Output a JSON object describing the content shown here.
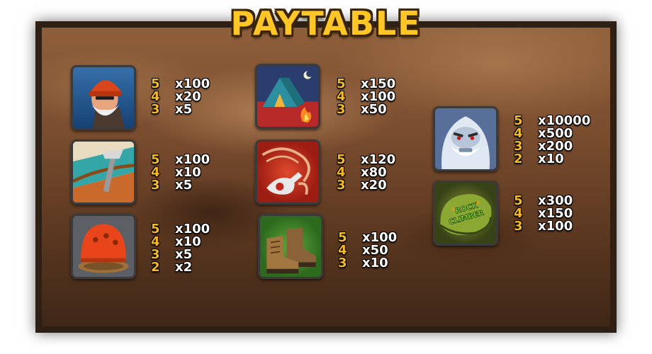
{
  "title": "PAYTABLE",
  "symbols": [
    {
      "name": "climber",
      "pays": [
        {
          "count": "5",
          "mult": "x100"
        },
        {
          "count": "4",
          "mult": "x20"
        },
        {
          "count": "3",
          "mult": "x5"
        }
      ]
    },
    {
      "name": "ice-axe",
      "pays": [
        {
          "count": "5",
          "mult": "x100"
        },
        {
          "count": "4",
          "mult": "x10"
        },
        {
          "count": "3",
          "mult": "x5"
        }
      ]
    },
    {
      "name": "helmet",
      "pays": [
        {
          "count": "5",
          "mult": "x100"
        },
        {
          "count": "4",
          "mult": "x10"
        },
        {
          "count": "3",
          "mult": "x5"
        },
        {
          "count": "2",
          "mult": "x2"
        }
      ]
    },
    {
      "name": "tent",
      "pays": [
        {
          "count": "5",
          "mult": "x150"
        },
        {
          "count": "4",
          "mult": "x100"
        },
        {
          "count": "3",
          "mult": "x50"
        }
      ]
    },
    {
      "name": "rope-hook",
      "pays": [
        {
          "count": "5",
          "mult": "x120"
        },
        {
          "count": "4",
          "mult": "x80"
        },
        {
          "count": "3",
          "mult": "x20"
        }
      ]
    },
    {
      "name": "boots",
      "pays": [
        {
          "count": "5",
          "mult": "x100"
        },
        {
          "count": "4",
          "mult": "x50"
        },
        {
          "count": "3",
          "mult": "x10"
        }
      ]
    },
    {
      "name": "yeti",
      "pays": [
        {
          "count": "5",
          "mult": "x10000"
        },
        {
          "count": "4",
          "mult": "x500"
        },
        {
          "count": "3",
          "mult": "x200"
        },
        {
          "count": "2",
          "mult": "x10"
        }
      ]
    },
    {
      "name": "rock-climber",
      "pays": [
        {
          "count": "5",
          "mult": "x300"
        },
        {
          "count": "4",
          "mult": "x150"
        },
        {
          "count": "3",
          "mult": "x100"
        }
      ],
      "logo_text": "ROCK CLIMBER"
    }
  ]
}
